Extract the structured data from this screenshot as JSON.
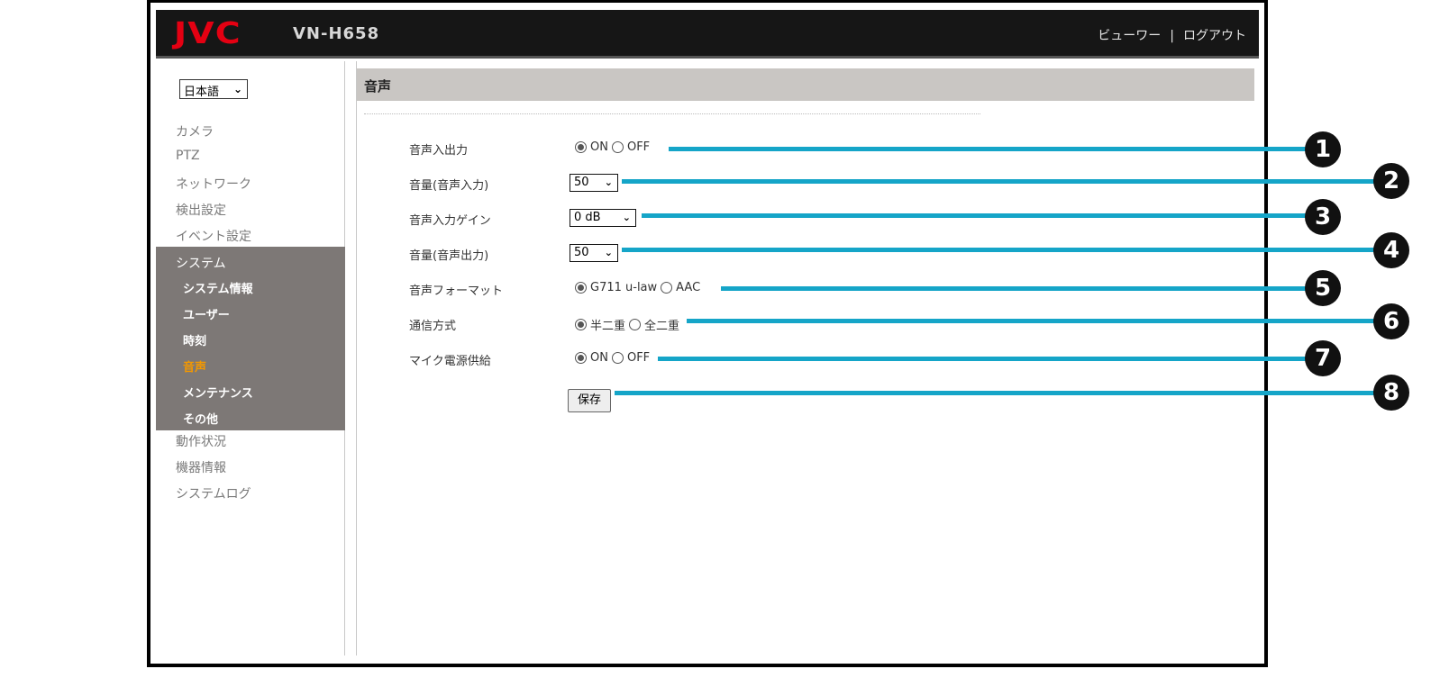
{
  "header": {
    "logo": "JVC",
    "model": "VN-H658",
    "viewer_link": "ビューワー",
    "separator": "|",
    "logout_link": "ログアウト"
  },
  "sidebar": {
    "language_value": "日本語",
    "items": [
      "カメラ",
      "PTZ",
      "ネットワーク",
      "検出設定",
      "イベント設定"
    ],
    "system_label": "システム",
    "system_subitems": [
      "システム情報",
      "ユーザー",
      "時刻",
      "音声",
      "メンテナンス",
      "その他"
    ],
    "active_subitem": "音声",
    "after_items": [
      "動作状況",
      "機器情報",
      "システムログ"
    ]
  },
  "main": {
    "title": "音声",
    "settings": [
      {
        "label": "音声入出力",
        "type": "radio",
        "options": [
          "ON",
          "OFF"
        ],
        "selected": "ON"
      },
      {
        "label": "音量(音声入力)",
        "type": "select",
        "value": "50"
      },
      {
        "label": "音声入力ゲイン",
        "type": "select",
        "value": "0 dB"
      },
      {
        "label": "音量(音声出力)",
        "type": "select",
        "value": "50"
      },
      {
        "label": "音声フォーマット",
        "type": "radio",
        "options": [
          "G711 u-law",
          "AAC"
        ],
        "selected": "G711 u-law"
      },
      {
        "label": "通信方式",
        "type": "radio",
        "options": [
          "半二重",
          "全二重"
        ],
        "selected": "半二重"
      },
      {
        "label": "マイク電源供給",
        "type": "radio",
        "options": [
          "ON",
          "OFF"
        ],
        "selected": "ON"
      }
    ],
    "save_label": "保存"
  },
  "callouts": [
    "1",
    "2",
    "3",
    "4",
    "5",
    "6",
    "7",
    "8"
  ],
  "colors": {
    "callout_line": "#15a5c8",
    "active_menu": "#f39800",
    "logo": "#e40012"
  }
}
